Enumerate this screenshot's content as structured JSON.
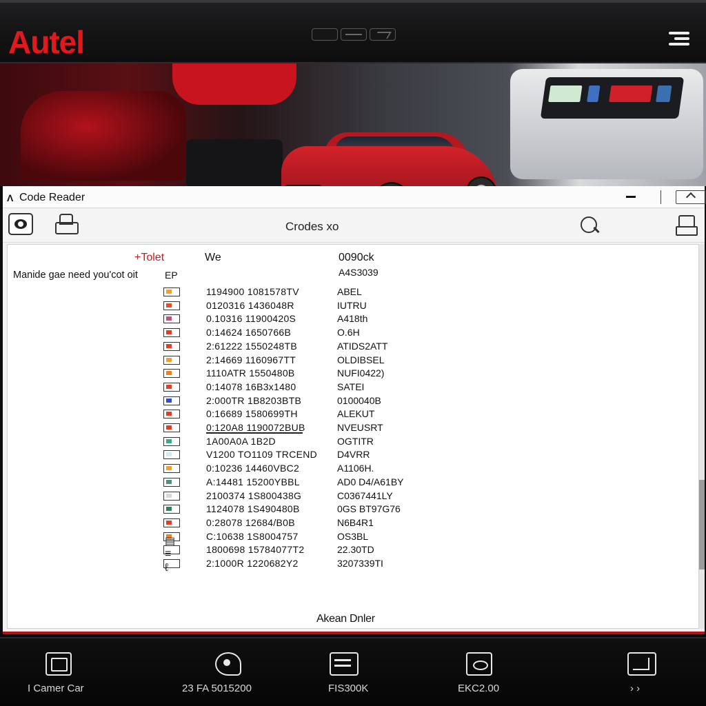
{
  "header": {
    "brand": "Autel"
  },
  "window": {
    "title": "Code Reader",
    "toolbar_title": "Crodes xo"
  },
  "table": {
    "headers": [
      "+Tolet",
      "We",
      "0090ck"
    ],
    "side_note": "Manide gae need you'cot oit",
    "ep_label": "EP",
    "ep_value": "A4S3039",
    "rows": [
      {
        "code": "1194900  1081578TV",
        "value": "ABEL",
        "color": "#f0a030"
      },
      {
        "code": "0120316  1436048R",
        "value": "IUTRU",
        "color": "#e05030"
      },
      {
        "code": "0.10316  11900420S",
        "value": "A418th",
        "color": "#c05080"
      },
      {
        "code": "0:14624  1650766B",
        "value": "O.6H",
        "color": "#e04020"
      },
      {
        "code": "2:61222  1550248TB",
        "value": "ATIDS2ATT",
        "color": "#e04020"
      },
      {
        "code": "2:14669  1160967TT",
        "value": "OLDIBSEL",
        "color": "#f0a030"
      },
      {
        "code": "1110ATR  1550480B",
        "value": "NUFI0422)",
        "color": "#f08020"
      },
      {
        "code": "0:14078  16B3x1480",
        "value": "SATEI",
        "color": "#e04020"
      },
      {
        "code": "2:000TR  1B8203BTB",
        "value": "0100040B",
        "color": "#3050c0"
      },
      {
        "code": "0:16689  1580699TH",
        "value": "ALEKUT",
        "color": "#e04020"
      },
      {
        "code": "0:120A8  1190072BUB",
        "value": "NVEUSRT",
        "color": "#e04020"
      },
      {
        "code": "1A00A0A  1B2D",
        "value": "OGTITR",
        "color": "#30b080"
      },
      {
        "code": "V1200 TO1109 TRCEND",
        "value": "D4VRR",
        "color": "#d8e8f0"
      },
      {
        "code": "0:10236  14460VBC2",
        "value": "A1106H.",
        "color": "#f0a030"
      },
      {
        "code": "A:14481  15200YBBL",
        "value": "AD0 D4/A61BY",
        "color": "#509080"
      },
      {
        "code": "2100374  1S800438G",
        "value": "C0367441LY",
        "color": "#d8d8d8"
      },
      {
        "code": "1124078  1S490480B",
        "value": "0GS BT97G76",
        "color": "#308060"
      },
      {
        "code": "0:28078  12684/B0B",
        "value": "N6B4R1",
        "color": "#e04020"
      },
      {
        "code": "C:10638  1S8004757",
        "value": "OS3BL",
        "color": "#f08020"
      },
      {
        "code": "1800698  15784077T2",
        "value": "22.30TD",
        "color": "#ffffff"
      },
      {
        "code": "2:1000R  1220682Y2",
        "value": "3207339TI",
        "color": "#ffffff"
      }
    ],
    "footer_note": "Akean Dnler"
  },
  "bottom_nav": [
    {
      "label": "I   Camer Car",
      "icon": "scanner-icon"
    },
    {
      "label": "23 FA 5015200",
      "icon": "diagnostic-icon"
    },
    {
      "label": "FIS300K",
      "icon": "tools-icon"
    },
    {
      "label": "EKC2.00",
      "icon": "vehicle-icon"
    },
    {
      "label": "› ›",
      "icon": "screen-icon"
    }
  ],
  "colors": {
    "brand_red": "#e0191d",
    "accent_red": "#b81218"
  }
}
